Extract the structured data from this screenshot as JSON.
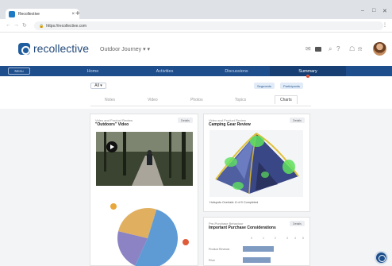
{
  "browser": {
    "tab_title": "Recollective",
    "tab_close": "×",
    "new_tab": "+",
    "url": "https://recollective.com",
    "controls": [
      "–",
      "□",
      "✕"
    ]
  },
  "header": {
    "logo_text": "recollective",
    "project_selector": "Outdoor Journey ▾ ▾"
  },
  "nav": {
    "menu_label": "Menu",
    "items": [
      "Home",
      "Activities",
      "Discussions",
      "Summary"
    ],
    "active_index": 3
  },
  "filters": {
    "all_label": "All ▾",
    "chips": [
      "Segments",
      "Participants"
    ]
  },
  "view_tabs": [
    "Notes",
    "Video",
    "Photos",
    "Topics",
    "Charts"
  ],
  "cards": {
    "video_card": {
      "source": "Video and Product Review",
      "title": "\"Outdoors\" Video",
      "details": "Details"
    },
    "tent_card": {
      "source": "Video and Product Review",
      "title": "Camping Gear Review",
      "details": "Details",
      "caption": "Hotspots Overlaid: 8 of 9 Completed"
    },
    "purchase_card": {
      "source": "Pre-Purchase Behaviour",
      "title": "Important Purchase Considerations",
      "details": "Details",
      "ticks": [
        "0",
        "1",
        "2",
        "3",
        "4",
        "5"
      ],
      "rows": [
        {
          "label": "Product Reviews",
          "value": 2.6
        },
        {
          "label": "Price",
          "value": 2.3
        }
      ]
    }
  },
  "chart_data": {
    "type": "pie",
    "values": [
      52,
      22,
      26
    ],
    "colors": [
      "#5e9bd5",
      "#8b83c4",
      "#e0b060"
    ]
  },
  "accent_color": "#1f4e8c"
}
